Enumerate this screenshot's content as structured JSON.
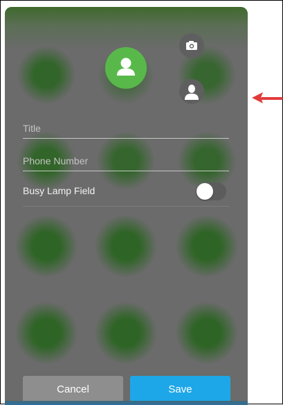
{
  "form": {
    "title_placeholder": "Title",
    "phone_placeholder": "Phone Number",
    "blf_label": "Busy Lamp Field",
    "blf_enabled": false
  },
  "buttons": {
    "cancel_label": "Cancel",
    "save_label": "Save"
  },
  "icons": {
    "avatar": "person-icon",
    "camera": "camera-icon",
    "contact_photo": "contact-silhouette-icon",
    "annotation": "red-arrow-icon"
  },
  "colors": {
    "avatar_bg": "#58b94a",
    "save_button": "#1ea7e8",
    "cancel_button": "#8e8e8e",
    "annotation_arrow": "#e23b3b"
  }
}
